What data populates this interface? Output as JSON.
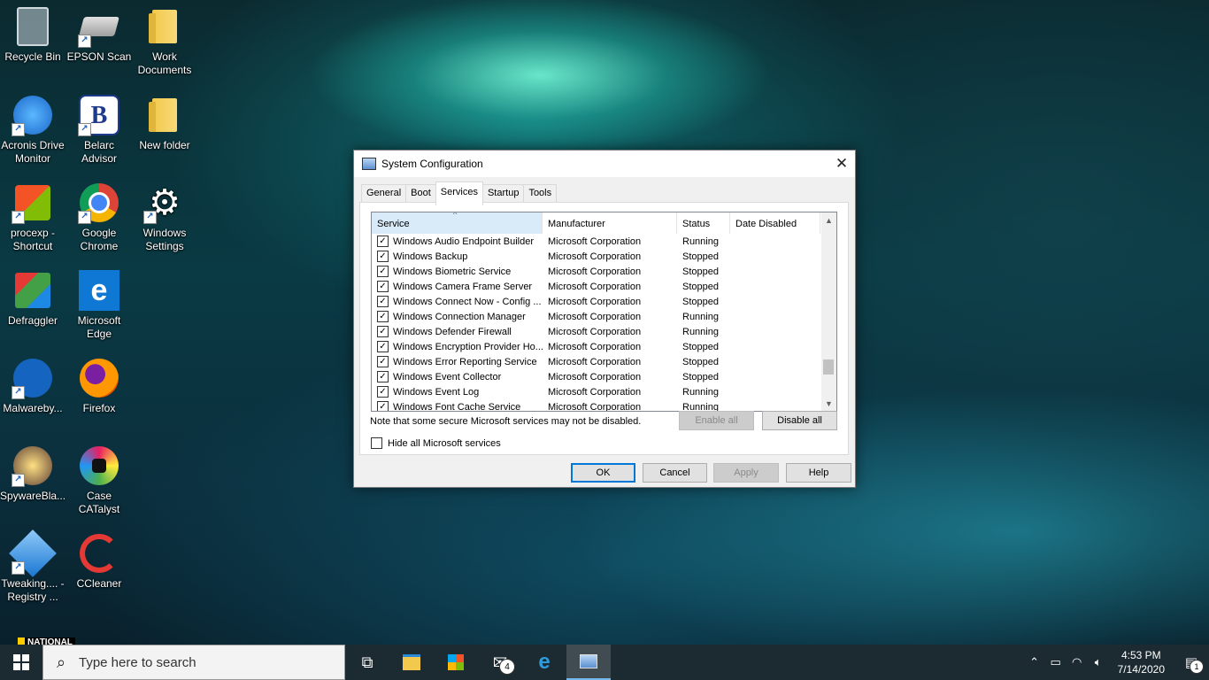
{
  "desktop": {
    "icons": [
      {
        "label": "Recycle Bin"
      },
      {
        "label": "EPSON Scan"
      },
      {
        "label": "Work Documents"
      },
      {
        "label": "Acronis Drive Monitor"
      },
      {
        "label": "Belarc Advisor"
      },
      {
        "label": "New folder"
      },
      {
        "label": "procexp - Shortcut"
      },
      {
        "label": "Google Chrome"
      },
      {
        "label": "Windows Settings"
      },
      {
        "label": "Defraggler"
      },
      {
        "label": "Microsoft Edge"
      },
      {
        "label": "Malwareby..."
      },
      {
        "label": "Firefox"
      },
      {
        "label": "SpywareBla..."
      },
      {
        "label": "Case CATalyst"
      },
      {
        "label": "Tweaking.... - Registry ..."
      },
      {
        "label": "CCleaner"
      }
    ],
    "partial_label": "NATIONAL"
  },
  "dialog": {
    "title": "System Configuration",
    "close_glyph": "✕",
    "tabs": [
      "General",
      "Boot",
      "Services",
      "Startup",
      "Tools"
    ],
    "active_tab": "Services",
    "columns": [
      "Service",
      "Manufacturer",
      "Status",
      "Date Disabled"
    ],
    "services": [
      {
        "name": "Windows Audio Endpoint Builder",
        "manufacturer": "Microsoft Corporation",
        "status": "Running",
        "date_disabled": ""
      },
      {
        "name": "Windows Backup",
        "manufacturer": "Microsoft Corporation",
        "status": "Stopped",
        "date_disabled": ""
      },
      {
        "name": "Windows Biometric Service",
        "manufacturer": "Microsoft Corporation",
        "status": "Stopped",
        "date_disabled": ""
      },
      {
        "name": "Windows Camera Frame Server",
        "manufacturer": "Microsoft Corporation",
        "status": "Stopped",
        "date_disabled": ""
      },
      {
        "name": "Windows Connect Now - Config ...",
        "manufacturer": "Microsoft Corporation",
        "status": "Stopped",
        "date_disabled": ""
      },
      {
        "name": "Windows Connection Manager",
        "manufacturer": "Microsoft Corporation",
        "status": "Running",
        "date_disabled": ""
      },
      {
        "name": "Windows Defender Firewall",
        "manufacturer": "Microsoft Corporation",
        "status": "Running",
        "date_disabled": ""
      },
      {
        "name": "Windows Encryption Provider Ho...",
        "manufacturer": "Microsoft Corporation",
        "status": "Stopped",
        "date_disabled": ""
      },
      {
        "name": "Windows Error Reporting Service",
        "manufacturer": "Microsoft Corporation",
        "status": "Stopped",
        "date_disabled": ""
      },
      {
        "name": "Windows Event Collector",
        "manufacturer": "Microsoft Corporation",
        "status": "Stopped",
        "date_disabled": ""
      },
      {
        "name": "Windows Event Log",
        "manufacturer": "Microsoft Corporation",
        "status": "Running",
        "date_disabled": ""
      },
      {
        "name": "Windows Font Cache Service",
        "manufacturer": "Microsoft Corporation",
        "status": "Running",
        "date_disabled": ""
      }
    ],
    "note": "Note that some secure Microsoft services may not be disabled.",
    "enable_all": "Enable all",
    "disable_all": "Disable all",
    "hide_ms_label": "Hide all Microsoft services",
    "hide_ms_checked": false,
    "buttons": {
      "ok": "OK",
      "cancel": "Cancel",
      "apply": "Apply",
      "help": "Help"
    }
  },
  "taskbar": {
    "search_placeholder": "Type here to search",
    "mail_badge": "4",
    "time": "4:53 PM",
    "date": "7/14/2020",
    "notification_count": "1"
  },
  "colors": {
    "accent": "#0078d7",
    "taskbar": "#1c2a32",
    "header_sorted": "#d9ebf9"
  }
}
